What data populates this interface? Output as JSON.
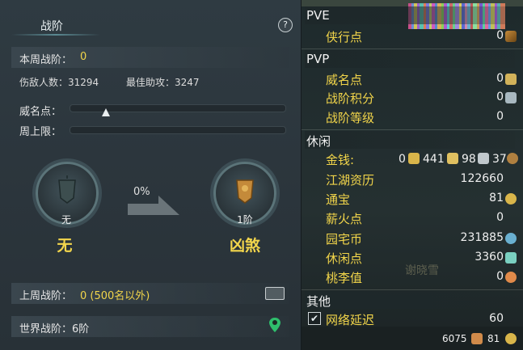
{
  "left": {
    "tab_title": "战阶",
    "help_label": "?",
    "weekly_rank_label": "本周战阶：",
    "weekly_rank_value": "0",
    "hurt_count": "伤敌人数：31294",
    "best_assist": "最佳助攻：3247",
    "prestige_label": "威名点：",
    "weekly_cap_label": "周上限：",
    "prestige_progress": 0.17,
    "weekly_cap_progress": 0,
    "progress_percent": "0%",
    "current_rank_sub": "无",
    "current_rank_name": "无",
    "next_rank_sub": "1阶",
    "next_rank_name": "凶煞",
    "last_week_label": "上周战阶：",
    "last_week_value": "0 (500名以外)",
    "world_rank": "世界战阶：6阶",
    "icons": [
      "help-icon",
      "chest-icon",
      "map-pin-icon"
    ]
  },
  "right": {
    "pve_title": "PVE",
    "pvp_title": "PVP",
    "leisure_title": "休闲",
    "other_title": "其他",
    "pve_items": [
      {
        "label": "侠行点",
        "value": "0",
        "icon": "brush-icon"
      }
    ],
    "pvp_items": [
      {
        "label": "威名点",
        "value": "0",
        "icon": "mask-icon"
      },
      {
        "label": "战阶积分",
        "value": "0",
        "icon": "cup-icon"
      },
      {
        "label": "战阶等级",
        "value": "0",
        "icon": ""
      }
    ],
    "money": {
      "label": "金钱:",
      "v1": "0",
      "v2": "441",
      "v3": "98",
      "v4": "37"
    },
    "leisure_items": [
      {
        "label": "江湖资历",
        "value": "122660",
        "icon": ""
      },
      {
        "label": "通宝",
        "value": "81",
        "icon": "coin-icon"
      },
      {
        "label": "薪火点",
        "value": "0",
        "icon": ""
      },
      {
        "label": "园宅币",
        "value": "231885",
        "icon": "swirl-icon"
      },
      {
        "label": "休闲点",
        "value": "3360",
        "icon": "leaf-icon"
      },
      {
        "label": "桃李值",
        "value": "0",
        "icon": "gourd-icon"
      }
    ],
    "latency_label": "网络延迟",
    "latency_value": "60",
    "watermark": "谢晓雪",
    "footer_v1": "6075",
    "footer_v2": "81",
    "colors": {
      "accent": "#f2d54a",
      "bg": "#232e30"
    }
  }
}
